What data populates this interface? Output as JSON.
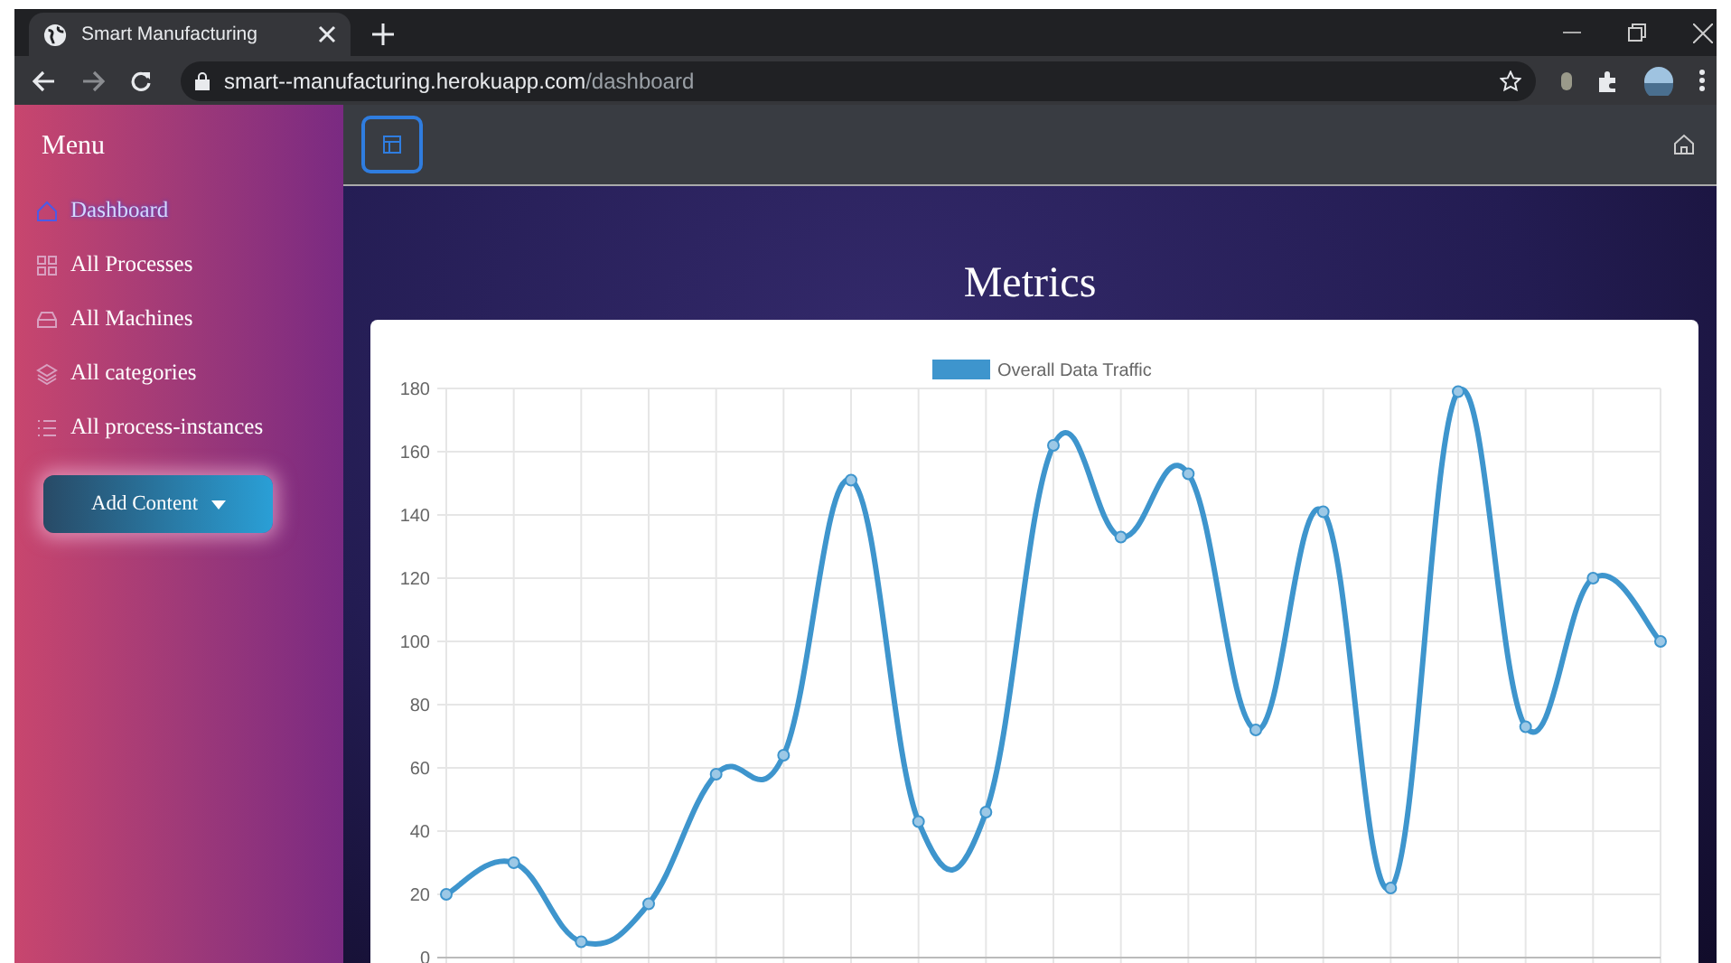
{
  "browser": {
    "tab_title": "Smart Manufacturing",
    "url_host": "smart--manufacturing.herokuapp.com",
    "url_path": "/dashboard"
  },
  "sidebar": {
    "title": "Menu",
    "items": [
      {
        "label": "Dashboard",
        "kind": "home",
        "selected": true
      },
      {
        "label": "All Processes",
        "kind": "grid",
        "selected": false
      },
      {
        "label": "All Machines",
        "kind": "machine",
        "selected": false
      },
      {
        "label": "All categories",
        "kind": "layers",
        "selected": false
      },
      {
        "label": "All process-instances",
        "kind": "list",
        "selected": false
      }
    ],
    "button": {
      "label": "Add Content"
    }
  },
  "main": {
    "heading": "Metrics",
    "chart_data": {
      "type": "line",
      "grid": true,
      "ylim": [
        0,
        180
      ],
      "yticks": [
        0,
        20,
        40,
        60,
        80,
        100,
        120,
        140,
        160,
        180
      ],
      "series": [
        {
          "name": "Overall Data Traffic",
          "color": "#3e95cd",
          "marker": true,
          "values": [
            20,
            30,
            5,
            17,
            58,
            64,
            151,
            43,
            46,
            162,
            133,
            153,
            72,
            141,
            22,
            179,
            73,
            120,
            100
          ]
        }
      ]
    }
  }
}
